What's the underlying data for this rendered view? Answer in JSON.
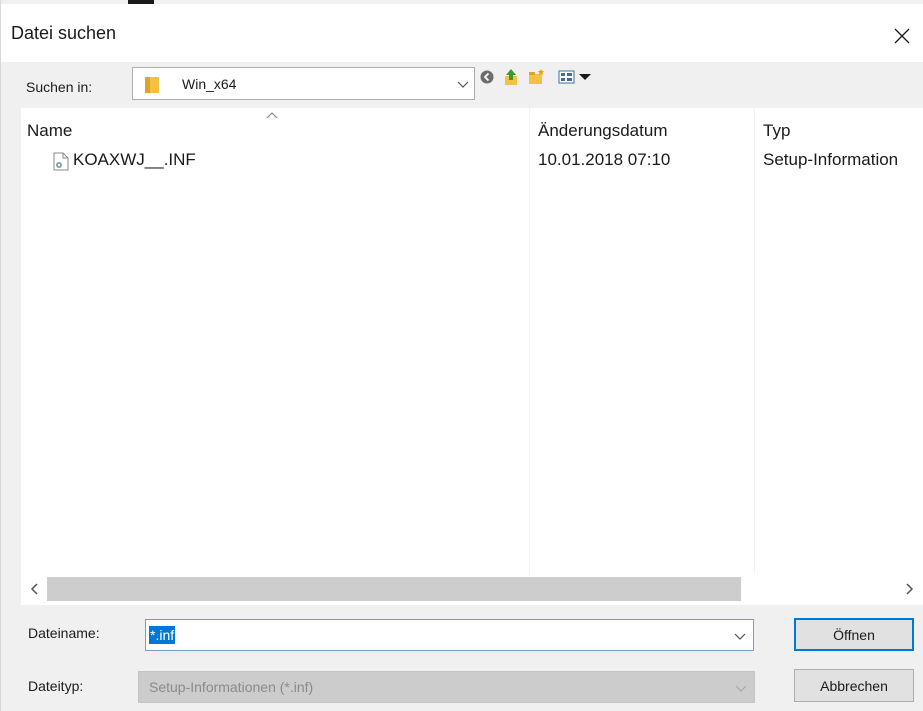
{
  "window": {
    "title": "Datei suchen"
  },
  "toolbar": {
    "look_in_label": "Suchen in:",
    "look_in_value": "Win_x64",
    "icons": [
      "back-icon",
      "up-folder-icon",
      "new-folder-icon",
      "view-menu-icon"
    ]
  },
  "file_list": {
    "columns": [
      "Name",
      "Änderungsdatum",
      "Typ"
    ],
    "sorted_column": "Name",
    "rows": [
      {
        "name": "KOAXWJ__.INF",
        "modified": "10.01.2018 07:10",
        "type": "Setup-Information"
      }
    ]
  },
  "footer": {
    "filename_label": "Dateiname:",
    "filename_value": "*.inf",
    "filetype_label": "Dateityp:",
    "filetype_value": "Setup-Informationen (*.inf)",
    "open_label": "Öffnen",
    "cancel_label": "Abbrechen"
  },
  "colors": {
    "accent": "#0078d7",
    "folder": "#f4c243",
    "scrollbar_thumb": "#cdcdcd"
  }
}
